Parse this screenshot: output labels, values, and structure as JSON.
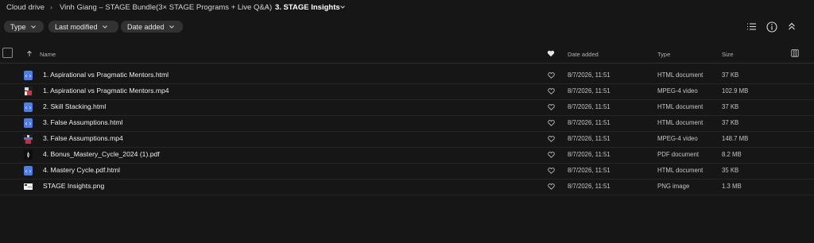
{
  "breadcrumb": {
    "items": [
      "Cloud drive",
      "Vinh Giang – STAGE Bundle(3× STAGE Programs + Live Q&A)"
    ],
    "current": "3. STAGE Insights"
  },
  "filters": [
    {
      "label": "Type"
    },
    {
      "label": "Last modified"
    },
    {
      "label": "Date added"
    }
  ],
  "columns": {
    "name": "Name",
    "date_added": "Date added",
    "type": "Type",
    "size": "Size"
  },
  "files": [
    {
      "name": "1. Aspirational vs Pragmatic Mentors.html",
      "date": "8/7/2026, 11:51",
      "type": "HTML document",
      "size": "37 KB",
      "icon": "html-file-icon"
    },
    {
      "name": "1. Aspirational vs Pragmatic Mentors.mp4",
      "date": "8/7/2026, 11:51",
      "type": "MPEG-4 video",
      "size": "102.9 MB",
      "icon": "video-thumbnail-icon"
    },
    {
      "name": "2. Skill Stacking.html",
      "date": "8/7/2026, 11:51",
      "type": "HTML document",
      "size": "37 KB",
      "icon": "html-file-icon"
    },
    {
      "name": "3. False Assumptions.html",
      "date": "8/7/2026, 11:51",
      "type": "HTML document",
      "size": "37 KB",
      "icon": "html-file-icon"
    },
    {
      "name": "3. False Assumptions.mp4",
      "date": "8/7/2026, 11:51",
      "type": "MPEG-4 video",
      "size": "148.7 MB",
      "icon": "video-thumbnail-icon"
    },
    {
      "name": "4. Bonus_Mastery_Cycle_2024 (1).pdf",
      "date": "8/7/2026, 11:51",
      "type": "PDF document",
      "size": "8.2 MB",
      "icon": "pdf-thumbnail-icon"
    },
    {
      "name": "4. Mastery Cycle.pdf.html",
      "date": "8/7/2026, 11:51",
      "type": "HTML document",
      "size": "35 KB",
      "icon": "html-file-icon"
    },
    {
      "name": "STAGE Insights.png",
      "date": "8/7/2026, 11:51",
      "type": "PNG image",
      "size": "1.3 MB",
      "icon": "image-thumbnail-icon"
    }
  ],
  "colors": {
    "background": "#161616",
    "chip": "#323232",
    "html_icon": "#4f7ee0"
  }
}
